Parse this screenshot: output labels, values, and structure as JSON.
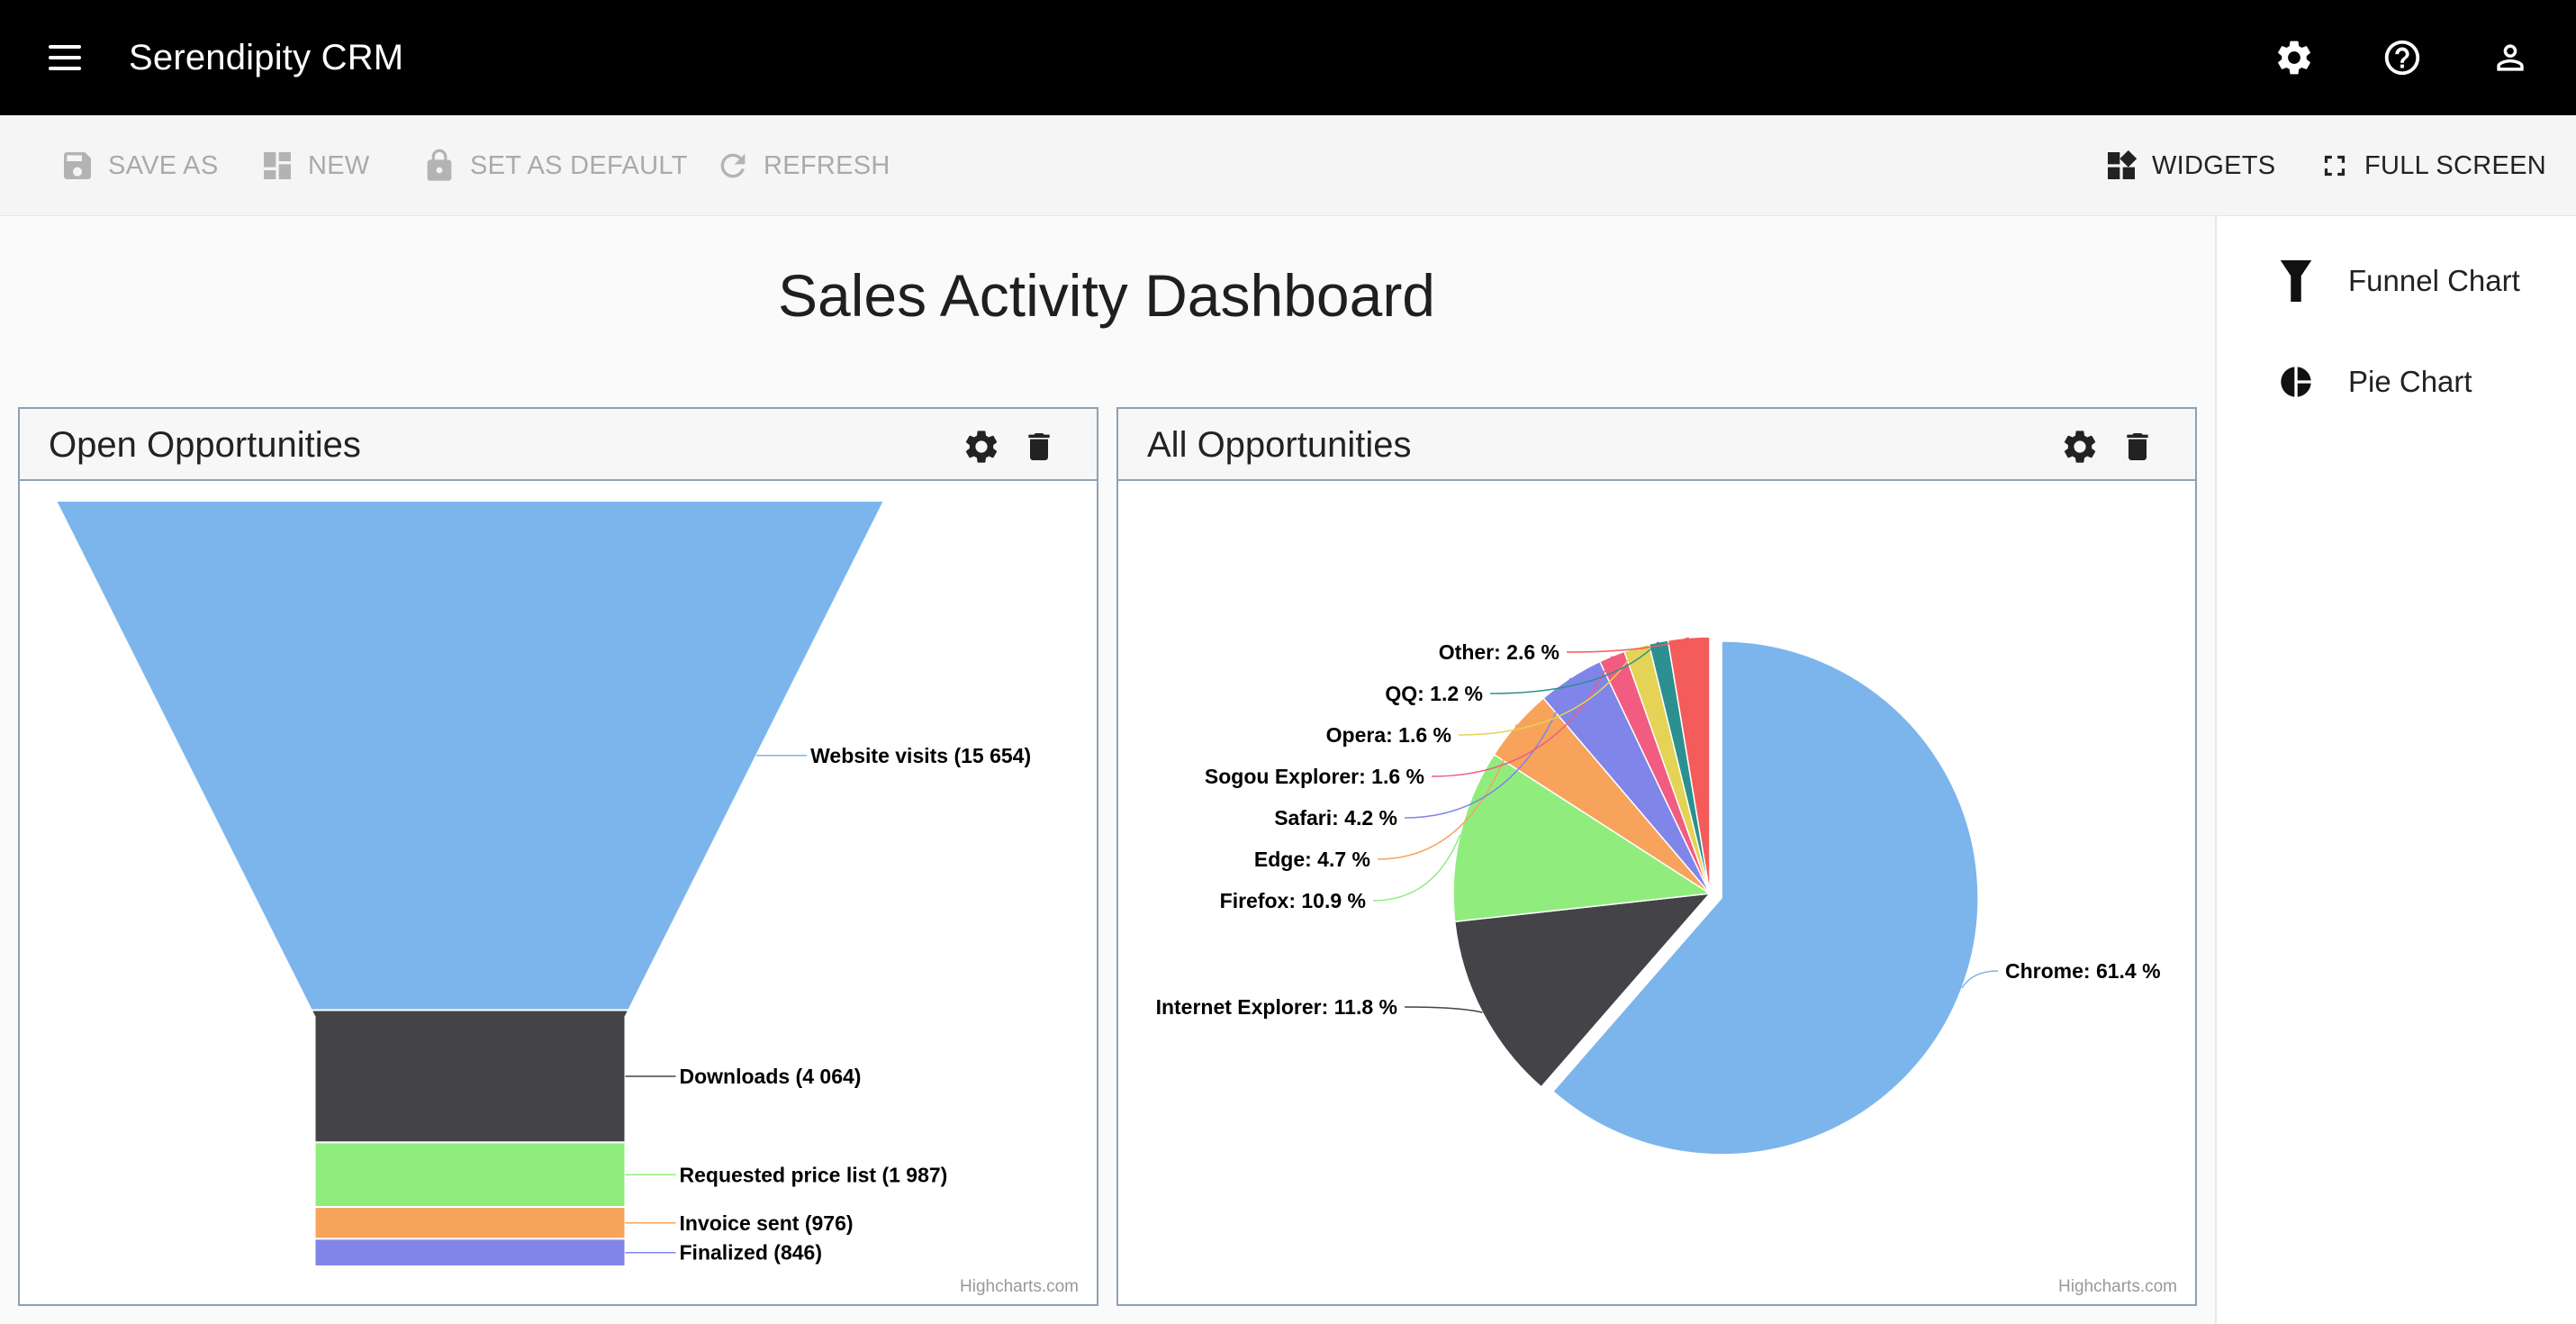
{
  "app": {
    "title": "Serendipity CRM"
  },
  "header_icons": [
    "settings-icon",
    "help-icon",
    "account-icon"
  ],
  "toolbar": {
    "save_as": "SAVE AS",
    "new": "NEW",
    "set_as_default": "SET AS DEFAULT",
    "refresh": "REFRESH",
    "widgets": "WIDGETS",
    "full_screen": "FULL SCREEN"
  },
  "dashboard": {
    "title": "Sales Activity Dashboard"
  },
  "widgets": [
    {
      "title": "Open Opportunities",
      "credit": "Highcharts.com",
      "chart_data": {
        "type": "funnel",
        "title": "",
        "categories": [
          "Website visits",
          "Downloads",
          "Requested price list",
          "Invoice sent",
          "Finalized"
        ],
        "values": [
          15654,
          4064,
          1987,
          976,
          846
        ],
        "labels": [
          "Website visits (15 654)",
          "Downloads (4 064)",
          "Requested price list (1 987)",
          "Invoice sent (976)",
          "Finalized (846)"
        ],
        "colors": [
          "#7cb5ec",
          "#434348",
          "#90ed7d",
          "#f7a35c",
          "#8085e9"
        ]
      }
    },
    {
      "title": "All Opportunities",
      "credit": "Highcharts.com",
      "chart_data": {
        "type": "pie",
        "title": "",
        "categories": [
          "Chrome",
          "Internet Explorer",
          "Firefox",
          "Edge",
          "Safari",
          "Sogou Explorer",
          "Opera",
          "QQ",
          "Other"
        ],
        "values": [
          61.41,
          11.84,
          10.85,
          4.67,
          4.18,
          1.64,
          1.6,
          1.2,
          2.61
        ],
        "labels": [
          "Chrome: 61.4 %",
          "Internet Explorer: 11.8 %",
          "Firefox: 10.9 %",
          "Edge: 4.7 %",
          "Safari: 4.2 %",
          "Sogou Explorer: 1.6 %",
          "Opera: 1.6 %",
          "QQ: 1.2 %",
          "Other: 2.6 %"
        ],
        "colors": [
          "#7cb5ec",
          "#434348",
          "#90ed7d",
          "#f7a35c",
          "#8085e9",
          "#f15c80",
          "#e4d354",
          "#2b908f",
          "#f45b5b"
        ],
        "sliced": "Chrome"
      }
    }
  ],
  "side_panel": {
    "items": [
      {
        "label": "Funnel Chart",
        "icon": "funnel-icon"
      },
      {
        "label": "Pie Chart",
        "icon": "pie-chart-icon"
      }
    ]
  }
}
